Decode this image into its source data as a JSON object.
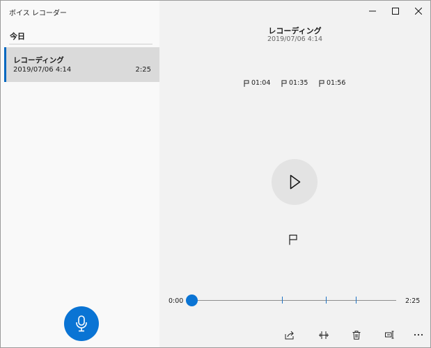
{
  "app": {
    "title": "ボイス レコーダー"
  },
  "sidebar": {
    "section_title": "今日",
    "recordings": [
      {
        "name": "レコーディング",
        "date": "2019/07/06 4:14",
        "duration": "2:25"
      }
    ]
  },
  "detail": {
    "title": "レコーディング",
    "date": "2019/07/06 4:14",
    "markers": [
      "01:04",
      "01:35",
      "01:56"
    ],
    "time_start": "0:00",
    "time_end": "2:25",
    "playback_progress": 0.0
  },
  "icons": {
    "record": "microphone-icon",
    "play": "play-icon",
    "add_marker": "flag-icon",
    "toolbar": [
      "share-icon",
      "trim-icon",
      "delete-icon",
      "rename-icon",
      "more-icon"
    ],
    "window": [
      "minimize-icon",
      "maximize-icon",
      "close-icon"
    ]
  },
  "colors": {
    "accent": "#0a74d4",
    "selection": "#dadada",
    "sidebar_bg": "#f9f9f9",
    "content_bg": "#f2f2f2"
  }
}
